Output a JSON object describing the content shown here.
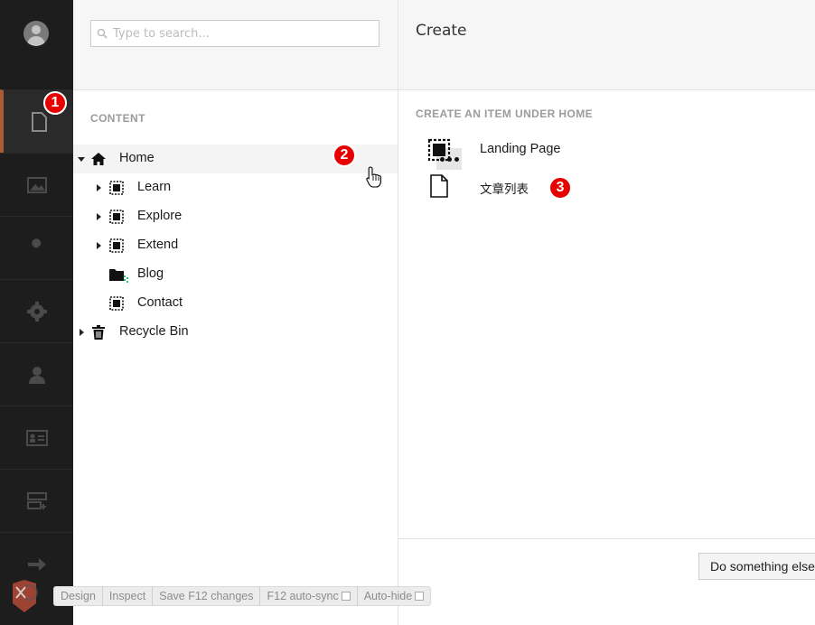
{
  "search": {
    "placeholder": "Type to search..."
  },
  "tree": {
    "section_label": "CONTENT",
    "home": "Home",
    "children": [
      "Learn",
      "Explore",
      "Extend",
      "Blog",
      "Contact"
    ],
    "recycle_bin": "Recycle Bin"
  },
  "create": {
    "title": "Create",
    "section_label": "CREATE AN ITEM UNDER HOME",
    "items": [
      "Landing Page",
      "文章列表"
    ],
    "other_button": "Do something else"
  },
  "badges": [
    "1",
    "2",
    "3"
  ],
  "debug_toolbar": {
    "design": "Design",
    "inspect": "Inspect",
    "save": "Save F12 changes",
    "autosync": "F12 auto-sync",
    "autohide": "Auto-hide"
  },
  "icons": {
    "sidebar": [
      "avatar",
      "content-icon",
      "media-icon",
      "settings-wrench-icon",
      "gear-icon",
      "user-icon",
      "member-card-icon",
      "forms-icon",
      "arrow-right-icon"
    ],
    "doc_types": [
      "landing-page-icon",
      "document-icon"
    ]
  },
  "colors": {
    "badge": "#e60000",
    "sidebar_bg": "#1d1d1d",
    "active_accent": "#a85d34",
    "folder_accent": "#2bc37c"
  }
}
